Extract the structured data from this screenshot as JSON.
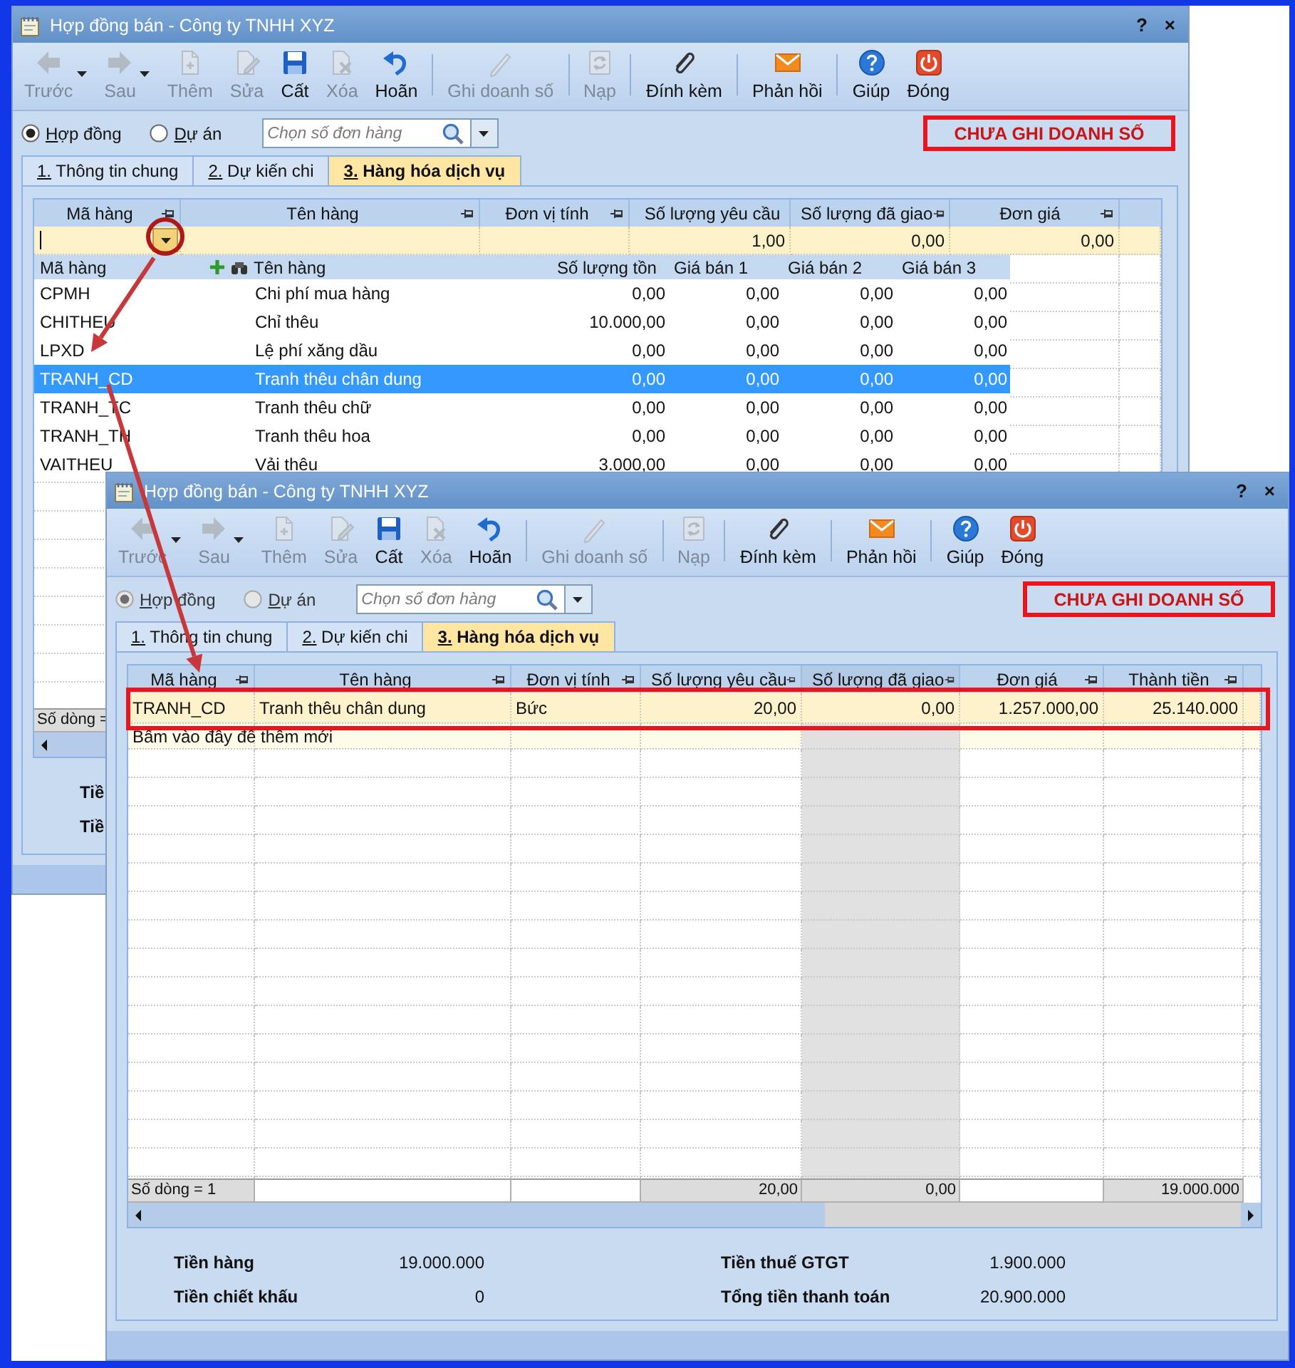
{
  "windows": [
    {
      "title": "Hợp đồng bán - Công ty TNHH XYZ",
      "title_buttons": [
        "?",
        "×"
      ],
      "toolbar_groups": [
        [
          {
            "kind": "back",
            "label": "Trước",
            "disabled": true,
            "dropdown": true
          },
          {
            "kind": "forward",
            "label": "Sau",
            "disabled": true,
            "dropdown": true
          },
          {
            "kind": "add",
            "label": "Thêm",
            "disabled": true,
            "dropdown": false
          },
          {
            "kind": "edit",
            "label": "Sửa",
            "disabled": true,
            "dropdown": false
          },
          {
            "kind": "save",
            "label": "Cất",
            "disabled": false,
            "dropdown": false
          },
          {
            "kind": "delete",
            "label": "Xóa",
            "disabled": true,
            "dropdown": false
          },
          {
            "kind": "undo",
            "label": "Hoãn",
            "disabled": false,
            "dropdown": false
          }
        ],
        [
          {
            "kind": "pen",
            "label": "Ghi doanh số",
            "disabled": true,
            "dropdown": false
          }
        ],
        [
          {
            "kind": "reload",
            "label": "Nạp",
            "disabled": true,
            "dropdown": false
          }
        ],
        [
          {
            "kind": "attach",
            "label": "Đính kèm",
            "disabled": false,
            "dropdown": false
          }
        ],
        [
          {
            "kind": "mail",
            "label": "Phản hồi",
            "disabled": false,
            "dropdown": false
          }
        ],
        [
          {
            "kind": "help",
            "label": "Giúp",
            "disabled": false,
            "dropdown": false
          },
          {
            "kind": "power",
            "label": "Đóng",
            "disabled": false,
            "dropdown": false
          }
        ]
      ],
      "modes": [
        {
          "label": "Hợp đồng",
          "selected": true,
          "disabled": false
        },
        {
          "label": "Dự án",
          "selected": false,
          "disabled": false
        }
      ],
      "search": {
        "placeholder": "Chọn số đơn hàng"
      },
      "status_badge": "CHƯA GHI DOANH SỐ",
      "tabs": [
        {
          "label": "1. Thông tin chung",
          "selected": false
        },
        {
          "label": "2. Dự kiến chi",
          "selected": false
        },
        {
          "label": "3. Hàng hóa dịch vụ",
          "selected": true
        }
      ],
      "grid": {
        "columns": [
          {
            "label": "Mã hàng",
            "pinned": true,
            "kind": "text"
          },
          {
            "label": "Tên hàng",
            "pinned": true,
            "kind": "text"
          },
          {
            "label": "Đơn vị tính",
            "pinned": true,
            "kind": "text"
          },
          {
            "label": "Số lượng yêu cầu",
            "pinned": false,
            "kind": "number"
          },
          {
            "label": "Số lượng đã giao",
            "pinned": true,
            "kind": "number"
          },
          {
            "label": "Đơn giá",
            "pinned": true,
            "kind": "number"
          }
        ],
        "entry_row": {
          "cells": [
            {
              "kind": "input"
            },
            {
              "kind": "blank"
            },
            {
              "kind": "blank"
            },
            {
              "kind": "value",
              "value": "1,00"
            },
            {
              "kind": "value",
              "value": "0,00"
            },
            {
              "kind": "value",
              "value": "0,00"
            }
          ]
        },
        "lookup": {
          "columns": [
            {
              "label": "Mã hàng",
              "kind": "code"
            },
            {
              "label": "Tên hàng",
              "kind": "name"
            },
            {
              "label": "Số lượng tồn",
              "kind": "number"
            },
            {
              "label": "Giá bán 1",
              "kind": "number"
            },
            {
              "label": "Giá bán 2",
              "kind": "number"
            },
            {
              "label": "Giá bán 3",
              "kind": "number"
            }
          ],
          "rows": [
            {
              "cells": [
                "CPMH",
                "Chi phí mua hàng",
                "0,00",
                "0,00",
                "0,00",
                "0,00"
              ],
              "selected": false
            },
            {
              "cells": [
                "CHITHEU",
                "Chỉ thêu",
                "10.000,00",
                "0,00",
                "0,00",
                "0,00"
              ],
              "selected": false
            },
            {
              "cells": [
                "LPXD",
                "Lệ phí xăng dầu",
                "0,00",
                "0,00",
                "0,00",
                "0,00"
              ],
              "selected": false
            },
            {
              "cells": [
                "TRANH_CD",
                "Tranh thêu chân dung",
                "0,00",
                "0,00",
                "0,00",
                "0,00"
              ],
              "selected": true
            },
            {
              "cells": [
                "TRANH_TC",
                "Tranh thêu chữ",
                "0,00",
                "0,00",
                "0,00",
                "0,00"
              ],
              "selected": false
            },
            {
              "cells": [
                "TRANH_TH",
                "Tranh thêu hoa",
                "0,00",
                "0,00",
                "0,00",
                "0,00"
              ],
              "selected": false
            },
            {
              "cells": [
                "VAITHEU",
                "Vải thêu",
                "3.000,00",
                "0,00",
                "0,00",
                "0,00"
              ],
              "selected": false
            }
          ]
        },
        "footer": {
          "label": "Số dòng ="
        }
      },
      "totals": [
        {
          "label": "Tiề"
        },
        {
          "label": "Tiề"
        }
      ]
    },
    {
      "title": "Hợp đồng bán - Công ty TNHH XYZ",
      "title_buttons": [
        "?",
        "×"
      ],
      "toolbar_groups": [
        [
          {
            "kind": "back",
            "label": "Trước",
            "disabled": true,
            "dropdown": true
          },
          {
            "kind": "forward",
            "label": "Sau",
            "disabled": true,
            "dropdown": true
          },
          {
            "kind": "add",
            "label": "Thêm",
            "disabled": true,
            "dropdown": false
          },
          {
            "kind": "edit",
            "label": "Sửa",
            "disabled": true,
            "dropdown": false
          },
          {
            "kind": "save",
            "label": "Cất",
            "disabled": false,
            "dropdown": false
          },
          {
            "kind": "delete",
            "label": "Xóa",
            "disabled": true,
            "dropdown": false
          },
          {
            "kind": "undo",
            "label": "Hoãn",
            "disabled": false,
            "dropdown": false
          }
        ],
        [
          {
            "kind": "pen",
            "label": "Ghi doanh số",
            "disabled": true,
            "dropdown": false
          }
        ],
        [
          {
            "kind": "reload",
            "label": "Nạp",
            "disabled": true,
            "dropdown": false
          }
        ],
        [
          {
            "kind": "attach",
            "label": "Đính kèm",
            "disabled": false,
            "dropdown": false
          }
        ],
        [
          {
            "kind": "mail",
            "label": "Phản hồi",
            "disabled": false,
            "dropdown": false
          }
        ],
        [
          {
            "kind": "help",
            "label": "Giúp",
            "disabled": false,
            "dropdown": false
          },
          {
            "kind": "power",
            "label": "Đóng",
            "disabled": false,
            "dropdown": false
          }
        ]
      ],
      "modes": [
        {
          "label": "Hợp đồng",
          "selected": true,
          "disabled": true
        },
        {
          "label": "Dự án",
          "selected": false,
          "disabled": true
        }
      ],
      "search": {
        "placeholder": "Chọn số đơn hàng"
      },
      "status_badge": "CHƯA GHI DOANH SỐ",
      "tabs": [
        {
          "label": "1. Thông tin chung",
          "selected": false
        },
        {
          "label": "2. Dự kiến chi",
          "selected": false
        },
        {
          "label": "3. Hàng hóa dịch vụ",
          "selected": true
        }
      ],
      "grid": {
        "columns": [
          {
            "label": "Mã hàng",
            "pinned": true,
            "kind": "text",
            "readonly": false
          },
          {
            "label": "Tên hàng",
            "pinned": true,
            "kind": "text",
            "readonly": false
          },
          {
            "label": "Đơn vị tính",
            "pinned": true,
            "kind": "text",
            "readonly": false
          },
          {
            "label": "Số lượng yêu cầu",
            "pinned": true,
            "kind": "number",
            "readonly": false
          },
          {
            "label": "Số lượng đã giao",
            "pinned": true,
            "kind": "number",
            "readonly": true
          },
          {
            "label": "Đơn giá",
            "pinned": true,
            "kind": "number",
            "readonly": false
          },
          {
            "label": "Thành tiền",
            "pinned": true,
            "kind": "number",
            "readonly": false
          }
        ],
        "rows": [
          {
            "cells": [
              "TRANH_CD",
              "Tranh thêu chân dung",
              "Bức",
              "20,00",
              "0,00",
              "1.257.000,00",
              "25.140.000"
            ],
            "selected": true
          }
        ],
        "add_row_hint": "Bấm vào đây để thêm mới",
        "footer": {
          "label": "Số dòng = 1",
          "sums": [
            {
              "kind": "blank"
            },
            {
              "kind": "blank"
            },
            {
              "kind": "sum",
              "value": "20,00"
            },
            {
              "kind": "sum",
              "value": "0,00"
            },
            {
              "kind": "blank"
            },
            {
              "kind": "sum",
              "value": "19.000.000"
            }
          ]
        }
      },
      "totals": [
        {
          "label": "Tiền hàng",
          "value": "19.000.000"
        },
        {
          "label": "Tiền chiết khấu",
          "value": "0"
        },
        {
          "label": "Tiền thuế GTGT",
          "value": "1.900.000"
        },
        {
          "label": "Tổng tiền thanh toán",
          "value": "20.900.000"
        }
      ]
    }
  ],
  "annotations": [
    {
      "kind": "circle"
    },
    {
      "kind": "arrow"
    },
    {
      "kind": "arrow"
    },
    {
      "kind": "frame"
    }
  ]
}
